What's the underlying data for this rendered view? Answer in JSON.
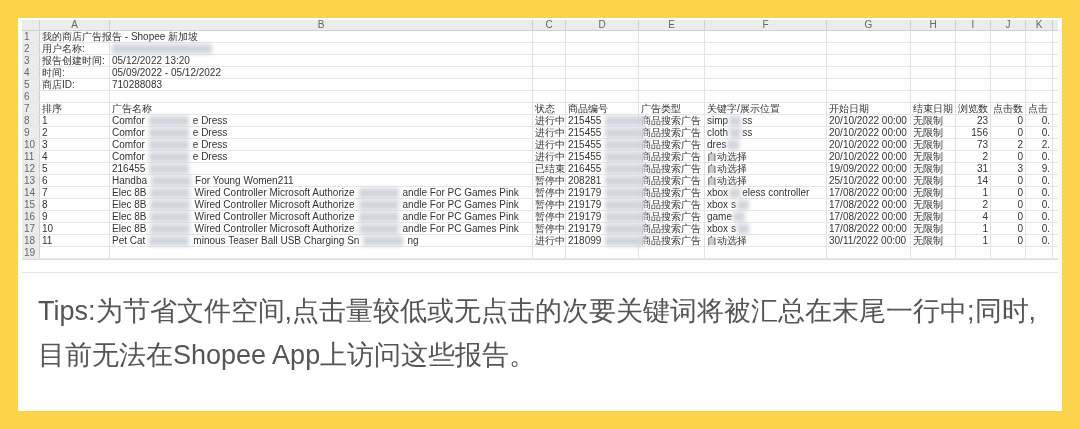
{
  "sheet": {
    "columns": [
      "A",
      "B",
      "C",
      "D",
      "E",
      "F",
      "G",
      "H",
      "I",
      "J",
      "K"
    ],
    "rows": [
      {
        "number": "1",
        "cells": [
          "我的商店广告报告 - Shopee 新加坡"
        ]
      },
      {
        "number": "2",
        "cells": [
          "用户名称:",
          {
            "kind": "redacted"
          }
        ]
      },
      {
        "number": "3",
        "cells": [
          "报告创建时间:",
          "05/12/2022 13:20"
        ]
      },
      {
        "number": "4",
        "cells": [
          "时间:",
          "05/09/2022 - 05/12/2022"
        ]
      },
      {
        "number": "5",
        "cells": [
          "商店ID:",
          "710288083"
        ]
      },
      {
        "number": "6",
        "cells": []
      },
      {
        "number": "7",
        "cells": [
          "排序",
          "广告名称",
          "状态",
          "商品编号",
          "广告类型",
          "关键字/展示位置",
          "开始日期",
          "结束日期",
          "浏览数",
          "点击数",
          "点击"
        ]
      },
      {
        "number": "8",
        "cells": [
          "1",
          [
            "Comfor",
            "e Dress"
          ],
          "进行中",
          [
            "215455"
          ],
          "商品搜索广告",
          [
            "simp",
            "ss"
          ],
          "20/10/2022 00:00",
          "无限制",
          "23",
          "0",
          "0."
        ]
      },
      {
        "number": "9",
        "cells": [
          "2",
          [
            "Comfor",
            "e Dress"
          ],
          "进行中",
          [
            "215455"
          ],
          "商品搜索广告",
          [
            "cloth",
            "ss"
          ],
          "20/10/2022 00:00",
          "无限制",
          "156",
          "0",
          "0."
        ]
      },
      {
        "number": "10",
        "cells": [
          "3",
          [
            "Comfor",
            "e Dress"
          ],
          "进行中",
          [
            "215455"
          ],
          "商品搜索广告",
          [
            "dres"
          ],
          "20/10/2022 00:00",
          "无限制",
          "73",
          "2",
          "2."
        ]
      },
      {
        "number": "11",
        "cells": [
          "4",
          [
            "Comfor",
            "e Dress"
          ],
          "进行中",
          [
            "215455"
          ],
          "商品搜索广告",
          "自动选择",
          "20/10/2022 00:00",
          "无限制",
          "2",
          "0",
          "0."
        ]
      },
      {
        "number": "12",
        "cells": [
          "5",
          [
            "216455"
          ],
          "已结束",
          [
            "216455"
          ],
          "商品搜索广告",
          "自动选择",
          "19/09/2022 00:00",
          "无限制",
          "31",
          "3",
          "9."
        ]
      },
      {
        "number": "13",
        "cells": [
          "6",
          [
            "Handba",
            "For Young Women211"
          ],
          "暂停中",
          [
            "208281"
          ],
          "商品搜索广告",
          "自动选择",
          "25/10/2022 00:00",
          "无限制",
          "14",
          "0",
          "0."
        ]
      },
      {
        "number": "14",
        "cells": [
          "7",
          [
            "Elec 8B",
            "Wired Controller Microsoft Authorize",
            "andle For PC Games Pink"
          ],
          "暂停中",
          [
            "219179"
          ],
          "商品搜索广告",
          [
            "xbox",
            "eless controller"
          ],
          "17/08/2022 00:00",
          "无限制",
          "1",
          "0",
          "0."
        ]
      },
      {
        "number": "15",
        "cells": [
          "8",
          [
            "Elec 8B",
            "Wired Controller Microsoft Authorize",
            "andle For PC Games Pink"
          ],
          "暂停中",
          [
            "219179"
          ],
          "商品搜索广告",
          [
            "xbox s"
          ],
          "17/08/2022 00:00",
          "无限制",
          "2",
          "0",
          "0."
        ]
      },
      {
        "number": "16",
        "cells": [
          "9",
          [
            "Elec 8B",
            "Wired Controller Microsoft Authorize",
            "andle For PC Games Pink"
          ],
          "暂停中",
          [
            "219179"
          ],
          "商品搜索广告",
          [
            "game"
          ],
          "17/08/2022 00:00",
          "无限制",
          "4",
          "0",
          "0."
        ]
      },
      {
        "number": "17",
        "cells": [
          "10",
          [
            "Elec 8B",
            "Wired Controller Microsoft Authorize",
            "andle For PC Games Pink"
          ],
          "暂停中",
          [
            "219179"
          ],
          "商品搜索广告",
          [
            "xbox s"
          ],
          "17/08/2022 00:00",
          "无限制",
          "1",
          "0",
          "0."
        ]
      },
      {
        "number": "18",
        "cells": [
          "11",
          [
            "Pet Cat",
            "minous Teaser Ball USB Charging Sn",
            "ng"
          ],
          "进行中",
          [
            "218099"
          ],
          "商品搜索广告",
          "自动选择",
          "30/11/2022 00:00",
          "无限制",
          "1",
          "0",
          "0."
        ]
      },
      {
        "number": "19",
        "cells": []
      }
    ]
  },
  "tips": "Tips:为节省文件空间,点击量较低或无点击的次要关键词将被汇总在末尾一行中;同时,目前无法在Shopee App上访问这些报告。"
}
